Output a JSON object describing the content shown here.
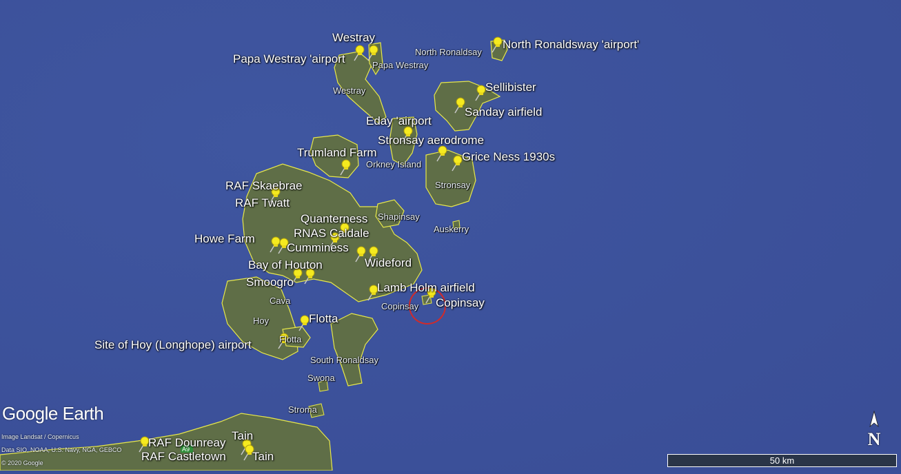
{
  "pin_labels": [
    {
      "text": "Westray"
    },
    {
      "text": "Papa Westray 'airport"
    },
    {
      "text": "North Ronaldsway 'airport'"
    },
    {
      "text": "Sellibister"
    },
    {
      "text": "Sanday airfield"
    },
    {
      "text": "Eday 'airport"
    },
    {
      "text": "Stronsay aerodrome"
    },
    {
      "text": "Trumland Farm"
    },
    {
      "text": "Grice Ness 1930s"
    },
    {
      "text": "RAF Skaebrae"
    },
    {
      "text": "RAF Twatt"
    },
    {
      "text": "Quanterness"
    },
    {
      "text": "RNAS Caldale"
    },
    {
      "text": "Howe Farm"
    },
    {
      "text": "Cumminess"
    },
    {
      "text": "Wideford"
    },
    {
      "text": "Bay of Houton"
    },
    {
      "text": "Smoogro"
    },
    {
      "text": "Lamb Holm airfield"
    },
    {
      "text": "Copinsay"
    },
    {
      "text": "Flotta"
    },
    {
      "text": "Site of Hoy (Longhope) airport"
    },
    {
      "text": "Tain"
    },
    {
      "text": "RAF Dounreay"
    },
    {
      "text": "RAF Castletown"
    },
    {
      "text": "Tain"
    }
  ],
  "place_labels": [
    {
      "text": "North Ronaldsay"
    },
    {
      "text": "Papa Westray"
    },
    {
      "text": "Westray"
    },
    {
      "text": "Orkney Island"
    },
    {
      "text": "Stronsay"
    },
    {
      "text": "Shapinsay"
    },
    {
      "text": "Auskerry"
    },
    {
      "text": "Copinsay"
    },
    {
      "text": "Cava"
    },
    {
      "text": "Hoy"
    },
    {
      "text": "Flotta"
    },
    {
      "text": "South Ronaldsay"
    },
    {
      "text": "Swona"
    },
    {
      "text": "Stroma"
    }
  ],
  "branding": {
    "logo": "Google Earth",
    "credit_image": "Image Landsat / Copernicus",
    "credit_data": "Data SIO, NOAA, U.S. Navy, NGA, GEBCO",
    "credit_copyright": "© 2020 Google",
    "road_label": "A9"
  },
  "scale": {
    "label": "50 km"
  },
  "compass": {
    "label": "N"
  },
  "colors": {
    "sea": "#3a4f99",
    "land": "#5f6e47",
    "border": "#e8e84a",
    "pin": "#f5ea1f"
  }
}
